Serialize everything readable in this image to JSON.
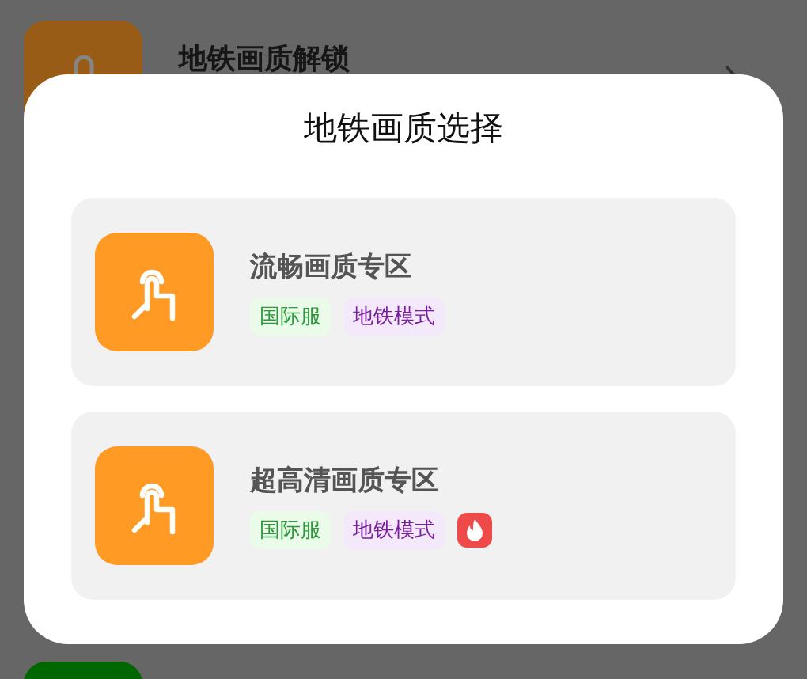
{
  "background": {
    "items": [
      {
        "title": "地铁画质解锁",
        "color": "#995c16"
      },
      {
        "color": "#006600"
      }
    ]
  },
  "dialog": {
    "title": "地铁画质选择",
    "options": [
      {
        "title": "流畅画质专区",
        "hot": false,
        "tags": [
          {
            "label": "国际服",
            "kind": "server"
          },
          {
            "label": "地铁模式",
            "kind": "mode"
          }
        ]
      },
      {
        "title": "超高清画质专区",
        "hot": true,
        "tags": [
          {
            "label": "国际服",
            "kind": "server"
          },
          {
            "label": "地铁模式",
            "kind": "mode"
          }
        ]
      }
    ]
  }
}
